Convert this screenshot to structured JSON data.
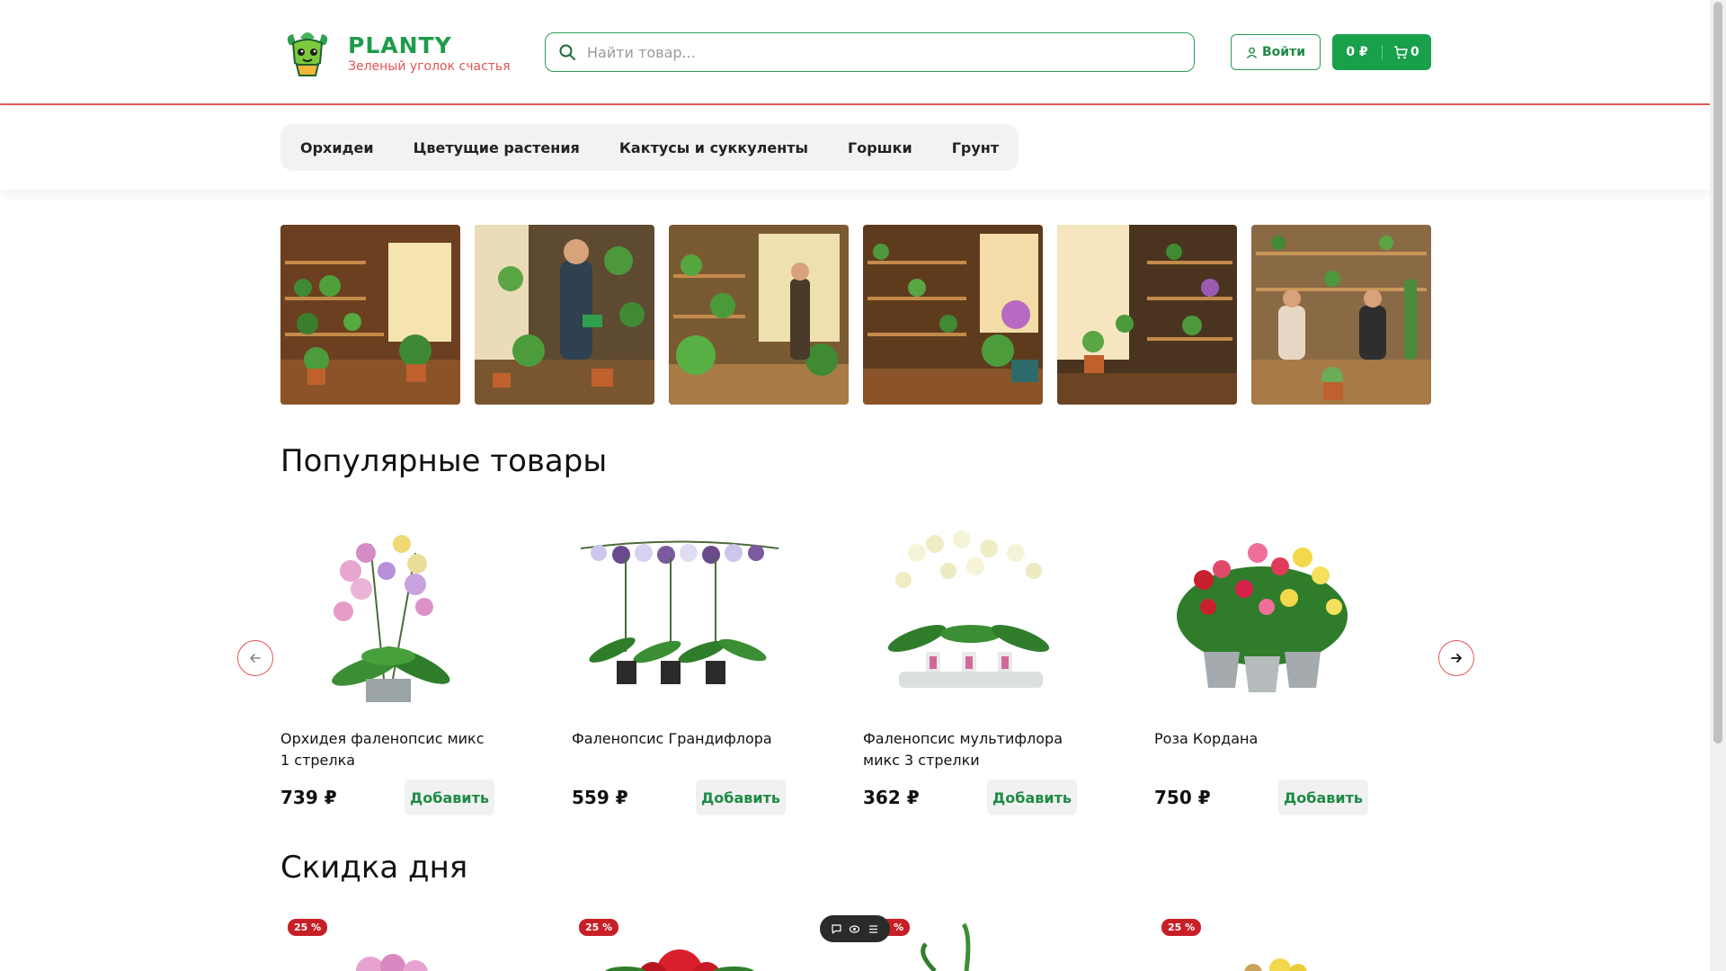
{
  "header": {
    "brand_name": "PLANTY",
    "slogan": "Зеленый уголок счастья",
    "search_placeholder": "Найти товар...",
    "login_label": "Войти",
    "cart_sum": "0 ₽",
    "cart_count": "0"
  },
  "nav": {
    "items": [
      "Орхидеи",
      "Цветущие растения",
      "Кактусы и суккуленты",
      "Горшки",
      "Грунт"
    ]
  },
  "popular": {
    "title": "Популярные товары",
    "add_label": "Добавить",
    "products": [
      {
        "name": "Орхидея фаленопсис микс 1 стрелка",
        "price": "739 ₽"
      },
      {
        "name": "Фаленопсис Грандифлора",
        "price": "559 ₽"
      },
      {
        "name": "Фаленопсис мультифлора микс 3 стрелки",
        "price": "362 ₽"
      },
      {
        "name": "Роза Кордана",
        "price": "750 ₽"
      }
    ]
  },
  "sale": {
    "title": "Скидка дня",
    "badges": [
      "25 %",
      "25 %",
      "25 %",
      "25 %"
    ]
  },
  "colors": {
    "brand_green": "#18a04a",
    "accent_red": "#e05a5a"
  }
}
